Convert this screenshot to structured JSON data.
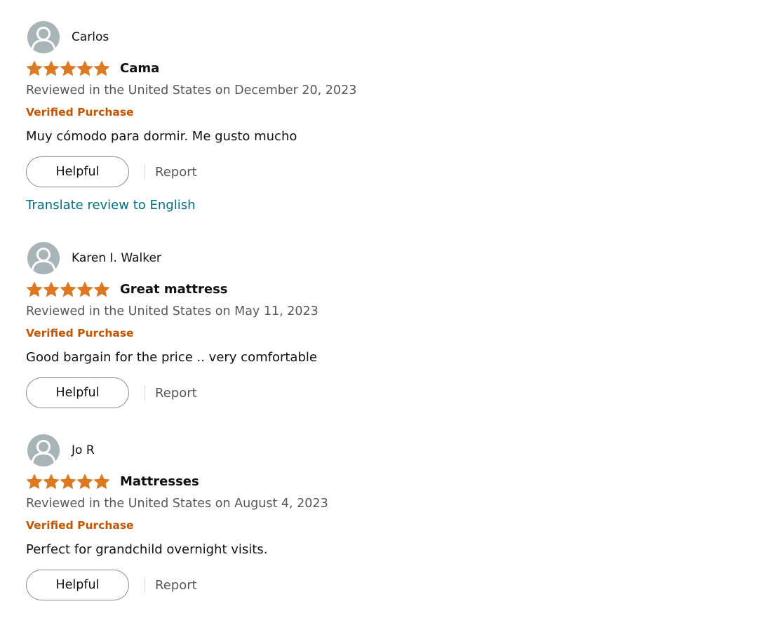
{
  "colors": {
    "star": "#de7921",
    "verified": "#c45500",
    "link": "#007185",
    "secondary_text": "#565959",
    "avatar_bg": "#a7b4b8"
  },
  "reviews": [
    {
      "reviewer": "Carlos",
      "avatar_icon": "default-user-avatar",
      "rating": 5,
      "rating_max": 5,
      "title": "Cama",
      "date_line": "Reviewed in the United States on December 20, 2023",
      "badge": "Verified Purchase",
      "body": "Muy cómodo para dormir. Me gusto mucho",
      "helpful_label": "Helpful",
      "report_label": "Report",
      "translate_label": "Translate review to English"
    },
    {
      "reviewer": "Karen I. Walker",
      "avatar_icon": "default-user-avatar",
      "rating": 5,
      "rating_max": 5,
      "title": "Great mattress",
      "date_line": "Reviewed in the United States on May 11, 2023",
      "badge": "Verified Purchase",
      "body": "Good bargain for the price .. very comfortable",
      "helpful_label": "Helpful",
      "report_label": "Report"
    },
    {
      "reviewer": "Jo R",
      "avatar_icon": "default-user-avatar",
      "rating": 5,
      "rating_max": 5,
      "title": "Mattresses",
      "date_line": "Reviewed in the United States on August 4, 2023",
      "badge": "Verified Purchase",
      "body": "Perfect for grandchild overnight visits.",
      "helpful_label": "Helpful",
      "report_label": "Report"
    }
  ]
}
